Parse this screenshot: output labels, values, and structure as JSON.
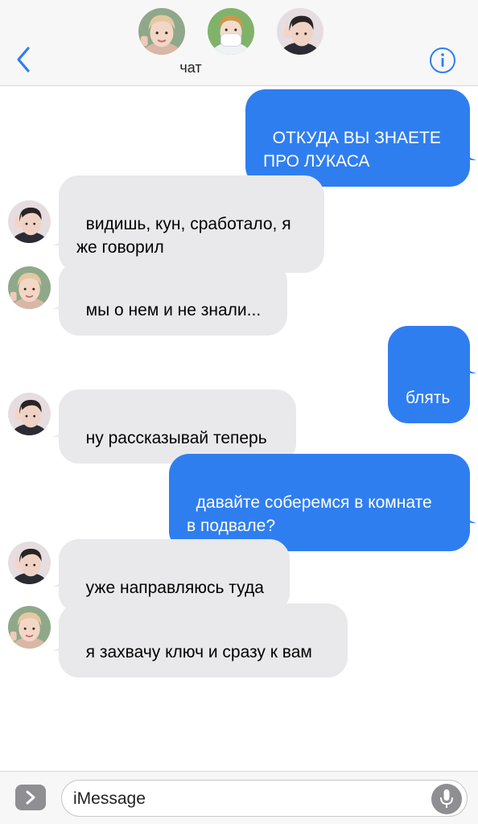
{
  "header": {
    "title": "чат",
    "back_icon": "chevron-left-icon",
    "info_icon": "info-icon",
    "accent_color": "#2f7ef0",
    "participants": [
      "avatar-1",
      "avatar-2",
      "avatar-3"
    ]
  },
  "messages": [
    {
      "direction": "outgoing",
      "text": "ОТКУДА ВЫ ЗНАЕТЕ\nПРО ЛУКАСА"
    },
    {
      "direction": "incoming",
      "avatar": "avatar-3",
      "text": "видишь, кун, сработало, я\nже говорил"
    },
    {
      "direction": "incoming",
      "avatar": "avatar-1",
      "text": "мы о нем и не знали..."
    },
    {
      "direction": "outgoing",
      "text": "блять"
    },
    {
      "direction": "incoming",
      "avatar": "avatar-3",
      "text": "ну рассказывай теперь"
    },
    {
      "direction": "outgoing",
      "text": "давайте соберемся в комнате\nв подвале?"
    },
    {
      "direction": "incoming",
      "avatar": "avatar-3",
      "text": "уже направляюсь туда"
    },
    {
      "direction": "incoming",
      "avatar": "avatar-1",
      "text": "я захвачу ключ и сразу к вам"
    }
  ],
  "input": {
    "placeholder": "iMessage",
    "apps_icon": "chevron-right-icon",
    "mic_icon": "microphone-icon"
  },
  "colors": {
    "outgoing_bubble": "#2f7ef0",
    "incoming_bubble": "#e9e9eb",
    "header_bg": "#f7f7f7"
  }
}
